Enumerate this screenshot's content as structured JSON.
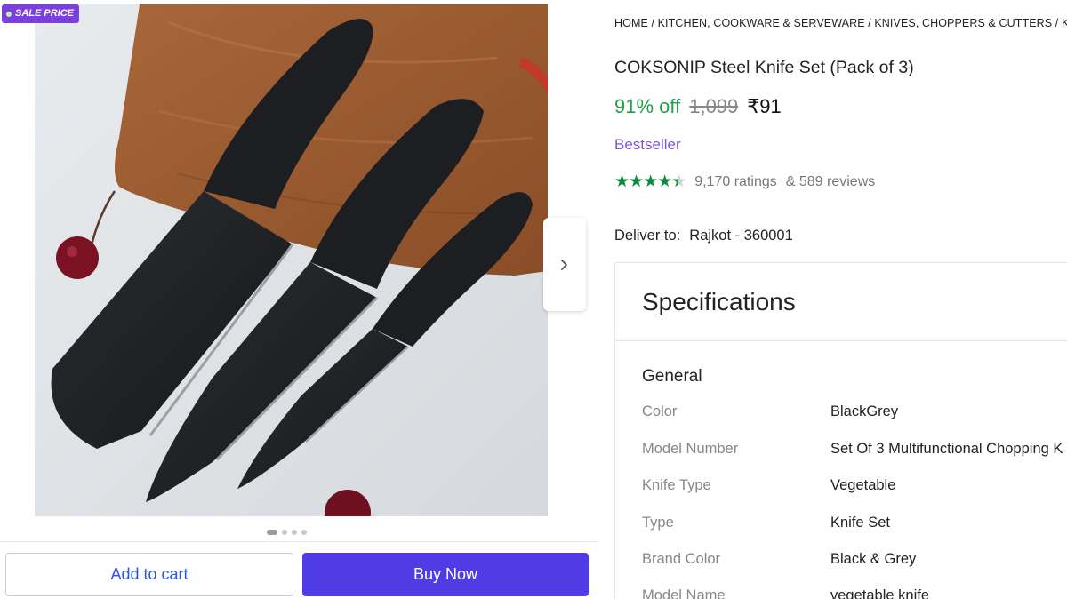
{
  "badge": {
    "label": "SALE PRICE"
  },
  "gallery": {
    "next_icon": "chevron-right-icon",
    "dots_count": 4,
    "active_dot": 0
  },
  "actions": {
    "add_to_cart": "Add to cart",
    "buy_now": "Buy Now"
  },
  "breadcrumb": "HOME / KITCHEN, COOKWARE & SERVEWARE / KNIVES, CHOPPERS & CUTTERS / KITCHE",
  "product": {
    "title": "COKSONIP Steel Knife Set (Pack of 3)",
    "discount": "91% off",
    "mrp": "1,099",
    "price": "₹91",
    "tag": "Bestseller",
    "rating_value": 4.5,
    "ratings_text": "9,170 ratings",
    "reviews_text": "& 589 reviews"
  },
  "delivery": {
    "label": "Deliver to:",
    "location": "Rajkot - 360001"
  },
  "specifications": {
    "heading": "Specifications",
    "group": "General",
    "rows": [
      {
        "key": "Color",
        "value": "BlackGrey"
      },
      {
        "key": "Model Number",
        "value": "Set Of 3 Multifunctional Chopping K"
      },
      {
        "key": "Knife Type",
        "value": "Vegetable"
      },
      {
        "key": "Type",
        "value": "Knife Set"
      },
      {
        "key": "Brand Color",
        "value": "Black & Grey"
      },
      {
        "key": "Model Name",
        "value": "vegetable knife"
      }
    ]
  },
  "colors": {
    "accent": "#4f3ce6",
    "discount": "#21a04a",
    "star": "#128a3e",
    "tag": "#7d58d6",
    "badge": "#7b3fe0"
  }
}
